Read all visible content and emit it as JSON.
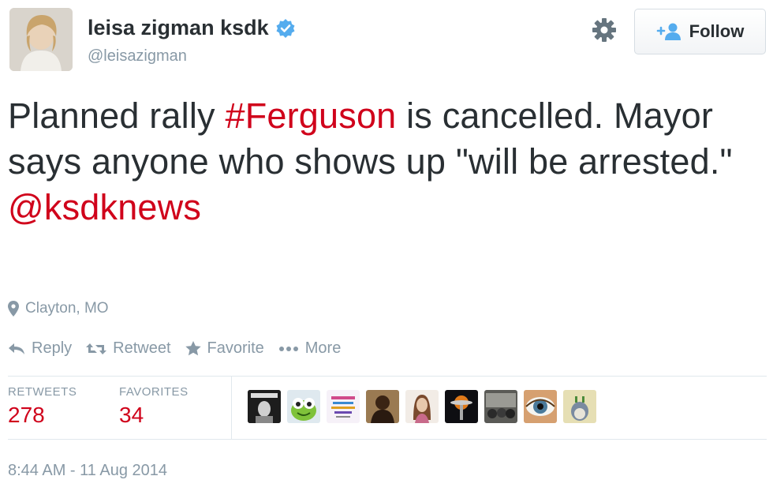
{
  "author": {
    "fullname": "leisa zigman ksdk",
    "handle": "@leisazigman",
    "verified": true
  },
  "header": {
    "follow_label": "Follow",
    "settings_icon": "gear-icon"
  },
  "tweet": {
    "text_part1": "Planned rally ",
    "hashtag": "#Ferguson",
    "text_part2": " is cancelled. Mayor says anyone who shows up \"will be arrested.\"",
    "mention": "@ksdknews",
    "location": "Clayton, MO"
  },
  "actions": {
    "reply": "Reply",
    "retweet": "Retweet",
    "favorite": "Favorite",
    "more": "More"
  },
  "stats": {
    "retweets_label": "RETWEETS",
    "retweets_count": "278",
    "favorites_label": "FAVORITES",
    "favorites_count": "34"
  },
  "favoriters": [
    {
      "name": "favoriter-avatar-1",
      "color": "#2a2a2a"
    },
    {
      "name": "favoriter-avatar-2",
      "color": "#7fc23a"
    },
    {
      "name": "favoriter-avatar-3",
      "color": "#f3ecf6"
    },
    {
      "name": "favoriter-avatar-4",
      "color": "#6b4a2a"
    },
    {
      "name": "favoriter-avatar-5",
      "color": "#e8d6c8"
    },
    {
      "name": "favoriter-avatar-6",
      "color": "#141418"
    },
    {
      "name": "favoriter-avatar-7",
      "color": "#6a6a66"
    },
    {
      "name": "favoriter-avatar-8",
      "color": "#b08a62"
    },
    {
      "name": "favoriter-avatar-9",
      "color": "#e6e0b8"
    }
  ],
  "timestamp": "8:44 AM - 11 Aug 2014",
  "colors": {
    "link": "#d0021b",
    "muted": "#8899a6",
    "verified_badge": "#55acee",
    "follow_icon": "#55acee"
  }
}
